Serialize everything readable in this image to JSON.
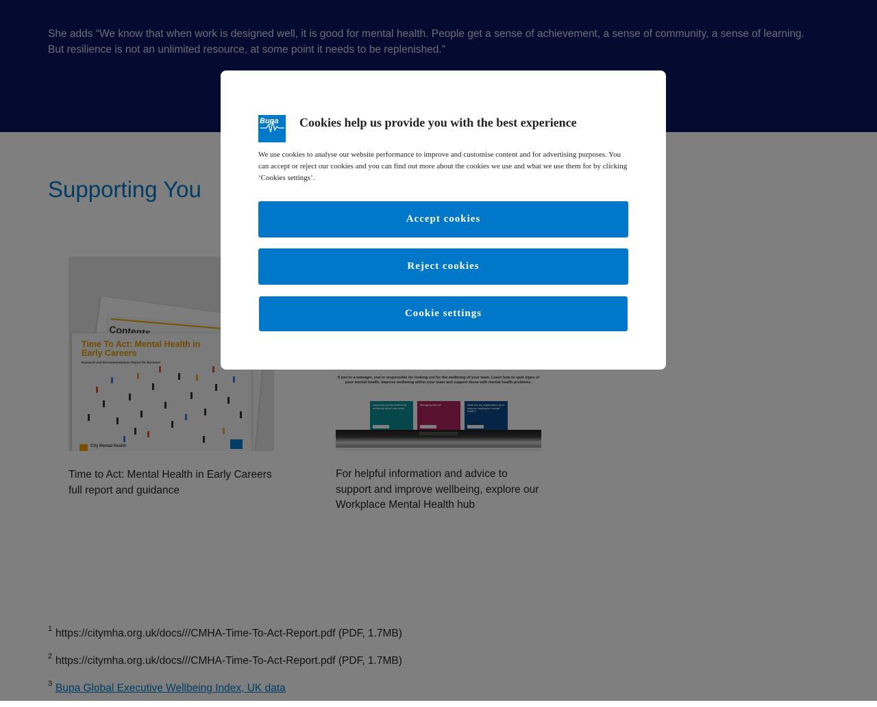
{
  "hero": {
    "quote": "She adds “We know that when work is designed well, it is good for mental health. People get a sense of achievement, a sense of community, a sense of learning. But resilience is not an unlimited resource, at some point it needs to be replenished.”"
  },
  "section": {
    "title": "Supporting You"
  },
  "cards": [
    {
      "text": "Time to Act: Mental Health in Early Careers full report and guidance",
      "image": {
        "contents_heading": "Contents",
        "cover_title": "Time To Act: Mental Health in Early Careers",
        "cover_subtitle": "Research and Recommendations Report for Business",
        "partner": "City Mental Health"
      }
    },
    {
      "text": "For helpful information and advice to support and improve wellbeing, explore our Workplace Mental Health hub",
      "image": {
        "heading": "If you're a manager, you're responsible for looking out for the wellbeing of your team. Learn how to spot signs of poor mental health, improve wellbeing within your team and support those with mental health problems.",
        "tiles": [
          "Improving mental health and wellbeing within your team",
          "Managing time off",
          "What can my organisation do to improve employees' mental health?"
        ]
      }
    }
  ],
  "footnotes": [
    {
      "num": "1",
      "text": "https://citymha.org.uk/docs///CMHA-Time-To-Act-Report.pdf (PDF, 1.7MB)"
    },
    {
      "num": "2",
      "text": "https://citymha.org.uk/docs///CMHA-Time-To-Act-Report.pdf (PDF, 1.7MB)"
    },
    {
      "num": "3",
      "text": "Bupa Global Executive Wellbeing Index, UK data"
    }
  ],
  "cookie_modal": {
    "logo": "Bupa",
    "title": "Cookies help us provide you with the best experience",
    "description": "We use cookies to analyse our website performance to improve and customise content and for advertising purposes. You can accept or reject our cookies and you can find out more about the cookies we use and what we use them for by clicking ‘Cookies settings’.",
    "accept_label": "Accept cookies",
    "reject_label": "Reject cookies",
    "settings_label": "Cookie settings"
  },
  "colors": {
    "hero_bg": "#0a1560",
    "accent": "#0079c8",
    "overlay": "rgba(0,0,0,0.5)"
  }
}
